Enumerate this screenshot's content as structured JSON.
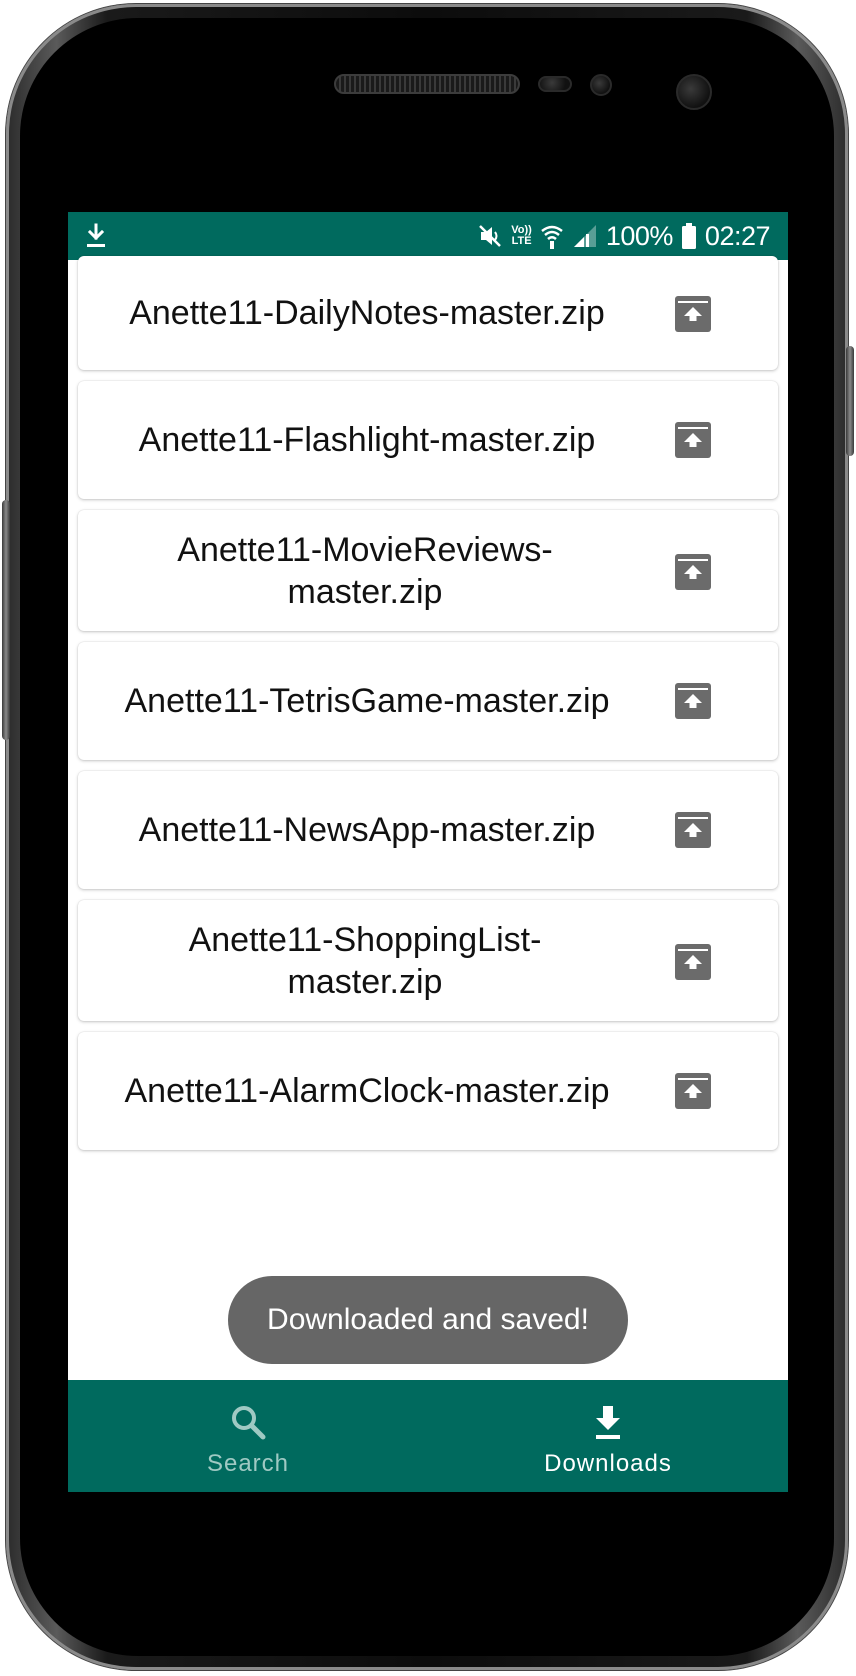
{
  "status_bar": {
    "left_icon": "download-icon",
    "icons": [
      "mute-icon",
      "volte-icon",
      "wifi-icon",
      "cell-signal-icon"
    ],
    "volte_label_top": "Vo))",
    "volte_label_bottom": "LTE",
    "battery_percent": "100%",
    "time": "02:27",
    "background_color": "#006a5e"
  },
  "downloads": {
    "items": [
      {
        "name": "Anette11-DailyNotes-master.zip",
        "icon": "upload-icon"
      },
      {
        "name": "Anette11-Flashlight-master.zip",
        "icon": "upload-icon"
      },
      {
        "name": "Anette11-MovieReviews-master.zip",
        "icon": "upload-icon"
      },
      {
        "name": "Anette11-TetrisGame-master.zip",
        "icon": "upload-icon"
      },
      {
        "name": "Anette11-NewsApp-master.zip",
        "icon": "upload-icon"
      },
      {
        "name": "Anette11-ShoppingList-master.zip",
        "icon": "upload-icon"
      },
      {
        "name": "Anette11-AlarmClock-master.zip",
        "icon": "upload-icon"
      }
    ]
  },
  "toast": {
    "message": "Downloaded and saved!"
  },
  "bottom_nav": {
    "items": [
      {
        "label": "Search",
        "icon": "search-icon",
        "active": false
      },
      {
        "label": "Downloads",
        "icon": "download-icon",
        "active": true
      }
    ],
    "background_color": "#006a5e",
    "active_color": "#ffffff",
    "inactive_color": "#9fc9c3"
  }
}
